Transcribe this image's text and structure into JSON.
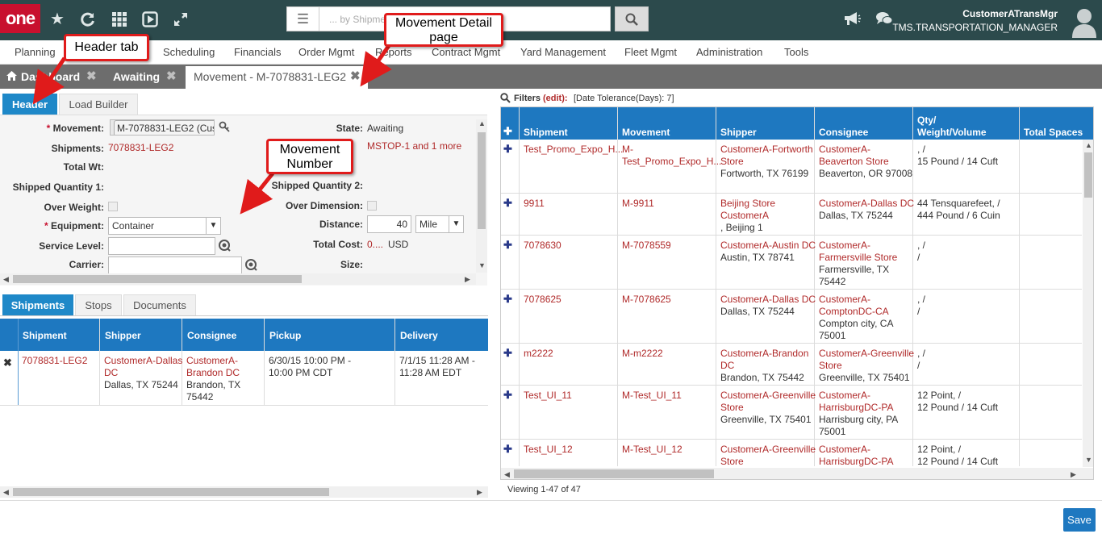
{
  "app": {
    "logo": "one"
  },
  "top_icons": [
    "star-icon",
    "refresh-icon",
    "grid-icon",
    "play-icon",
    "expand-icon"
  ],
  "search": {
    "placeholder": "... by Shipment"
  },
  "user": {
    "name": "CustomerATransMgr",
    "role": "TMS.TRANSPORTATION_MANAGER"
  },
  "menu": [
    "Planning",
    "Scheduling",
    "Financials",
    "Order Mgmt",
    "Reports",
    "Contract Mgmt",
    "Yard Management",
    "Fleet Mgmt",
    "Administration",
    "Tools"
  ],
  "tabs": [
    {
      "label": "Dashboard"
    },
    {
      "label": "Awaiting"
    },
    {
      "label": "Movement - M-7078831-LEG2"
    }
  ],
  "left": {
    "subtabs": [
      "Header",
      "Load Builder"
    ],
    "form": {
      "movement_label": "Movement:",
      "movement_value": "M-7078831-LEG2 (Custo",
      "shipments_label": "Shipments:",
      "shipments_value": "7078831-LEG2",
      "total_wt_label": "Total Wt:",
      "shipped_qty1_label": "Shipped Quantity 1:",
      "over_weight_label": "Over Weight:",
      "equipment_label": "Equipment:",
      "equipment_value": "Container",
      "service_level_label": "Service Level:",
      "carrier_label": "Carrier:",
      "state_label": "State:",
      "state_value": "Awaiting",
      "stops_value": "MSTOP-1 and 1 more",
      "shipped_qty2_label": "Shipped Quantity 2:",
      "over_dimension_label": "Over Dimension:",
      "distance_label": "Distance:",
      "distance_value": "40",
      "distance_unit": "Mile",
      "total_cost_label": "Total Cost:",
      "total_cost_value": "0....",
      "total_cost_currency": "USD",
      "size_label": "Size:"
    },
    "bottom_tabs": [
      "Shipments",
      "Stops",
      "Documents"
    ],
    "shipments_table": {
      "headers": [
        "Shipment",
        "Shipper",
        "Consignee",
        "Pickup",
        "Delivery"
      ],
      "rows": [
        {
          "shipment": "7078831-LEG2",
          "shipper": [
            "CustomerA-Dallas",
            "DC"
          ],
          "shipper_addr": "Dallas, TX 75244",
          "consignee": [
            "CustomerA-",
            "Brandon DC"
          ],
          "consignee_addr": [
            "Brandon, TX",
            "75442"
          ],
          "pickup": [
            "6/30/15 10:00 PM -",
            "10:00 PM CDT"
          ],
          "delivery": [
            "7/1/15 11:28 AM -",
            "11:28 AM EDT"
          ]
        }
      ]
    }
  },
  "right": {
    "filters_label": "Filters",
    "filters_edit": "(edit):",
    "filters_value": "[Date Tolerance(Days): 7]",
    "headers": [
      "Shipment",
      "Movement",
      "Shipper",
      "Consignee",
      "Qty/",
      "Weight/Volume",
      "Total Spaces"
    ],
    "rows": [
      {
        "shipment": "Test_Promo_Expo_H...",
        "movement": [
          "M-",
          "Test_Promo_Expo_H..."
        ],
        "shipper": [
          "CustomerA-Fortworth",
          "Store"
        ],
        "shipper_addr": [
          "Fortworth, TX 76199"
        ],
        "consignee": [
          "CustomerA-",
          "Beaverton Store"
        ],
        "consignee_addr": [
          "Beaverton, OR 97008"
        ],
        "qty": [
          ", /",
          "15 Pound / 14 Cuft"
        ]
      },
      {
        "shipment": "9911",
        "movement": [
          "M-9911"
        ],
        "shipper": [
          "Beijing Store",
          "CustomerA"
        ],
        "shipper_addr": [
          ", Beijing 1"
        ],
        "consignee": [
          "CustomerA-Dallas DC"
        ],
        "consignee_addr": [
          "Dallas, TX 75244"
        ],
        "qty": [
          "44 Tensquarefeet, /",
          "444 Pound / 6 Cuin"
        ]
      },
      {
        "shipment": "7078630",
        "movement": [
          "M-7078559"
        ],
        "shipper": [
          "CustomerA-Austin DC"
        ],
        "shipper_addr": [
          "Austin, TX 78741"
        ],
        "consignee": [
          "CustomerA-",
          "Farmersville Store"
        ],
        "consignee_addr": [
          "Farmersville, TX",
          "75442"
        ],
        "qty": [
          ", /",
          "/"
        ]
      },
      {
        "shipment": "7078625",
        "movement": [
          "M-7078625"
        ],
        "shipper": [
          "CustomerA-Dallas DC"
        ],
        "shipper_addr": [
          "Dallas, TX 75244"
        ],
        "consignee": [
          "CustomerA-",
          "ComptonDC-CA"
        ],
        "consignee_addr": [
          "Compton city, CA",
          "75001"
        ],
        "qty": [
          ", /",
          "/"
        ]
      },
      {
        "shipment": "m2222",
        "movement": [
          "M-m2222"
        ],
        "shipper": [
          "CustomerA-Brandon",
          "DC"
        ],
        "shipper_addr": [
          "Brandon, TX 75442"
        ],
        "consignee": [
          "CustomerA-Greenville",
          "Store"
        ],
        "consignee_addr": [
          "Greenville, TX 75401"
        ],
        "qty": [
          ", /",
          "/"
        ]
      },
      {
        "shipment": "Test_UI_11",
        "movement": [
          "M-Test_UI_11"
        ],
        "shipper": [
          "CustomerA-Greenville",
          "Store"
        ],
        "shipper_addr": [
          "Greenville, TX 75401"
        ],
        "consignee": [
          "CustomerA-",
          "HarrisburgDC-PA"
        ],
        "consignee_addr": [
          "Harrisburg city, PA",
          "75001"
        ],
        "qty": [
          "12 Point, /",
          "12 Pound / 14 Cuft"
        ]
      },
      {
        "shipment": "Test_UI_12",
        "movement": [
          "M-Test_UI_12"
        ],
        "shipper": [
          "CustomerA-Greenville",
          "Store"
        ],
        "shipper_addr": [],
        "consignee": [
          "CustomerA-",
          "HarrisburgDC-PA"
        ],
        "consignee_addr": [],
        "qty": [
          "12 Point, /",
          "12 Pound / 14 Cuft"
        ]
      }
    ],
    "viewing": "Viewing 1-47 of 47"
  },
  "callouts": {
    "header_tab": "Header tab",
    "movement_detail": [
      "Movement Detail",
      "page"
    ],
    "movement_number": [
      "Movement",
      "Number"
    ]
  },
  "save_label": "Save",
  "colors": {
    "topbar": "#2c4a4c",
    "brand_red": "#c8102e",
    "header_blue": "#1e78c0",
    "link_red": "#b02a2a",
    "callout_border": "#e01b1b"
  }
}
